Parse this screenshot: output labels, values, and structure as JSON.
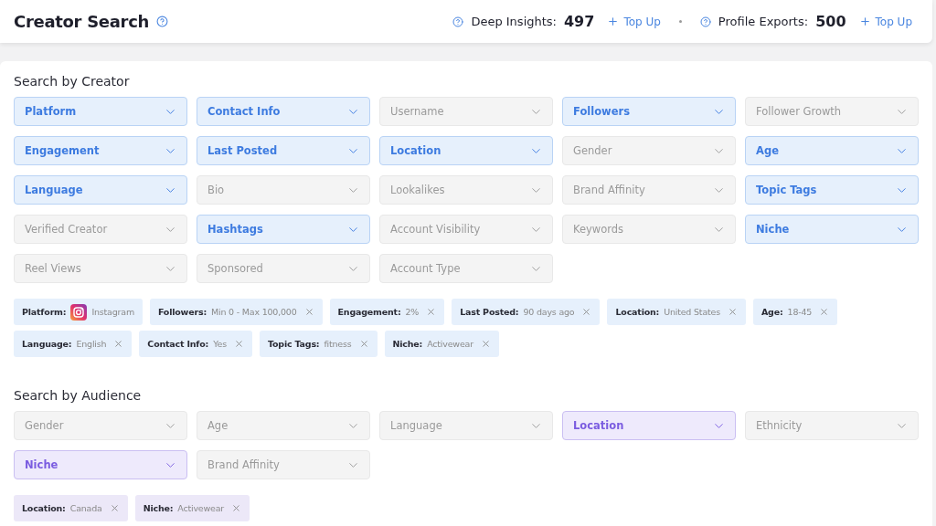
{
  "header": {
    "title": "Creator Search",
    "credits": [
      {
        "label": "Deep Insights:",
        "value": "497",
        "action": "Top Up"
      },
      {
        "label": "Profile Exports:",
        "value": "500",
        "action": "Top Up"
      }
    ]
  },
  "sections": [
    {
      "title": "Search by Creator",
      "kind": "creator",
      "filters": [
        {
          "label": "Platform",
          "active": true
        },
        {
          "label": "Contact Info",
          "active": true
        },
        {
          "label": "Username",
          "active": false
        },
        {
          "label": "Followers",
          "active": true
        },
        {
          "label": "Follower Growth",
          "active": false
        },
        {
          "label": "Engagement",
          "active": true
        },
        {
          "label": "Last Posted",
          "active": true
        },
        {
          "label": "Location",
          "active": true
        },
        {
          "label": "Gender",
          "active": false
        },
        {
          "label": "Age",
          "active": true
        },
        {
          "label": "Language",
          "active": true
        },
        {
          "label": "Bio",
          "active": false
        },
        {
          "label": "Lookalikes",
          "active": false
        },
        {
          "label": "Brand Affinity",
          "active": false
        },
        {
          "label": "Topic Tags",
          "active": true
        },
        {
          "label": "Verified Creator",
          "active": false
        },
        {
          "label": "Hashtags",
          "active": true
        },
        {
          "label": "Account Visibility",
          "active": false
        },
        {
          "label": "Keywords",
          "active": false
        },
        {
          "label": "Niche",
          "active": true
        },
        {
          "label": "Reel Views",
          "active": false
        },
        {
          "label": "Sponsored",
          "active": false
        },
        {
          "label": "Account Type",
          "active": false
        }
      ],
      "chips": [
        {
          "label": "Platform:",
          "value": "Instagram",
          "kind": "platform"
        },
        {
          "label": "Followers:",
          "value": "Min 0 - Max 100,000",
          "kind": "removable"
        },
        {
          "label": "Engagement:",
          "value": "2%",
          "kind": "removable"
        },
        {
          "label": "Last Posted:",
          "value": "90 days ago",
          "kind": "removable"
        },
        {
          "label": "Location:",
          "value": "United States",
          "kind": "removable"
        },
        {
          "label": "Age:",
          "value": "18-45",
          "kind": "removable"
        },
        {
          "label": "Language:",
          "value": "English",
          "kind": "removable"
        },
        {
          "label": "Contact Info:",
          "value": "Yes",
          "kind": "removable"
        },
        {
          "label": "Topic Tags:",
          "value": "fitness",
          "kind": "removable"
        },
        {
          "label": "Niche:",
          "value": "Activewear",
          "kind": "removable"
        }
      ]
    },
    {
      "title": "Search by Audience",
      "kind": "audience",
      "filters": [
        {
          "label": "Gender",
          "active": false
        },
        {
          "label": "Age",
          "active": false
        },
        {
          "label": "Language",
          "active": false
        },
        {
          "label": "Location",
          "active": true
        },
        {
          "label": "Ethnicity",
          "active": false
        },
        {
          "label": "Niche",
          "active": true
        },
        {
          "label": "Brand Affinity",
          "active": false
        }
      ],
      "chips": [
        {
          "label": "Location:",
          "value": "Canada",
          "kind": "removable"
        },
        {
          "label": "Niche:",
          "value": "Activewear",
          "kind": "removable"
        }
      ]
    }
  ]
}
